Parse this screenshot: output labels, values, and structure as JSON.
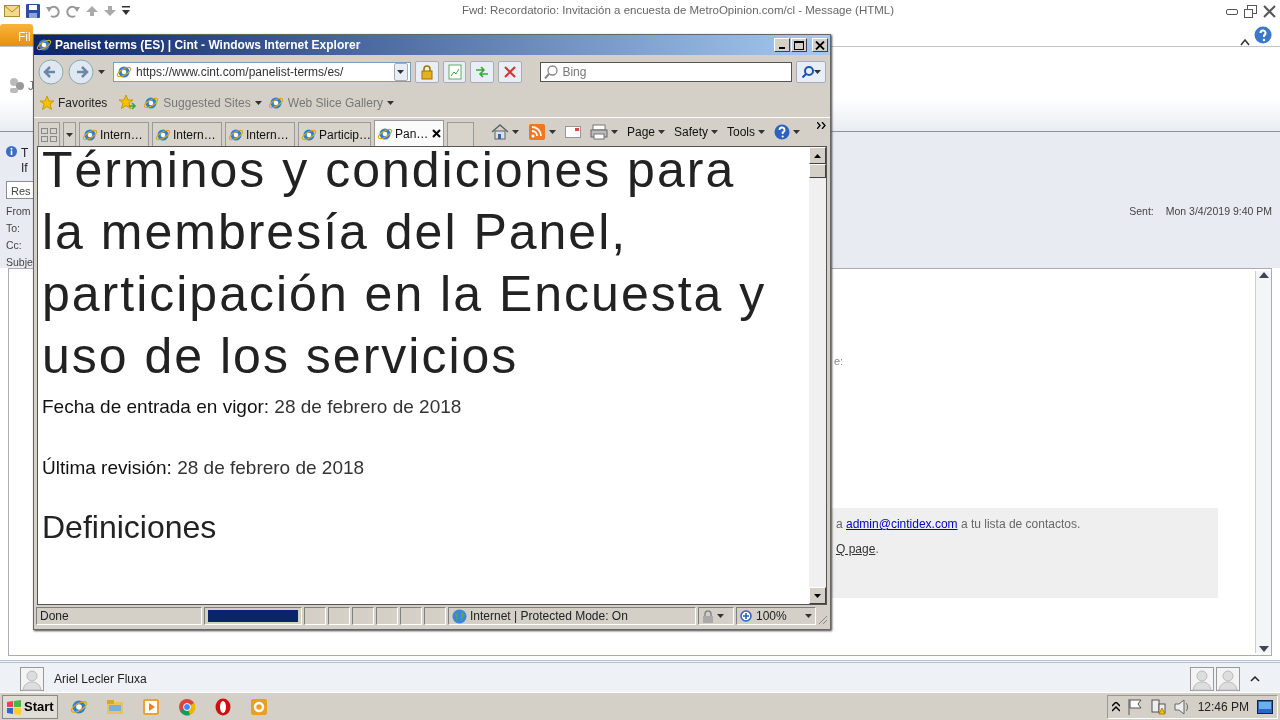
{
  "outlook": {
    "title": "Fwd: Recordatorio: Invitación a encuesta de MetroOpinion.com/cl - Message (HTML)",
    "file_tab": "Fil",
    "ribbon_fragment": "J",
    "info_lines": [
      "T",
      "If"
    ],
    "response_field": "Res",
    "header_labels": [
      "From",
      "To:",
      "Cc:",
      "Subje"
    ],
    "sent_label": "Sent:",
    "sent_value": "Mon 3/4/2019 9:40 PM",
    "body": {
      "fragment": "e:",
      "notice_prefix": "a",
      "notice_link": "admin@cintidex.com",
      "notice_suffix": "a tu lista de contactos.",
      "faq_link": "Q page",
      "faq_suffix": "."
    },
    "people_pane": {
      "name": "Ariel Lecler Fluxa"
    }
  },
  "ie": {
    "title": "Panelist terms (ES) | Cint - Windows Internet Explorer",
    "address": "https://www.cint.com/panelist-terms/es/",
    "search_placeholder": "Bing",
    "favorites": "Favorites",
    "fav_links": [
      "Suggested Sites",
      "Web Slice Gallery"
    ],
    "tabs": [
      {
        "label": "Intern…",
        "selected": false
      },
      {
        "label": "Intern…",
        "selected": false
      },
      {
        "label": "Intern…",
        "selected": false
      },
      {
        "label": "Particip…",
        "selected": false
      },
      {
        "label": "Pan…",
        "selected": true
      }
    ],
    "commands": [
      "Page",
      "Safety",
      "Tools"
    ],
    "page": {
      "heading": "Términos y condiciones para la membresía del Panel, participación en la Encuesta y uso de los servicios",
      "lines": [
        "**Fecha de entrada en vigor:** 28 de febrero de 2018",
        "**Última revisión:** 28 de febrero de 2018"
      ],
      "section": "Definiciones"
    },
    "status": {
      "text": "Done",
      "level": 1,
      "zone": "Internet | Protected Mode: On",
      "zoom": "100%"
    }
  },
  "taskbar": {
    "start": "Start",
    "clock": "12:46 PM"
  }
}
